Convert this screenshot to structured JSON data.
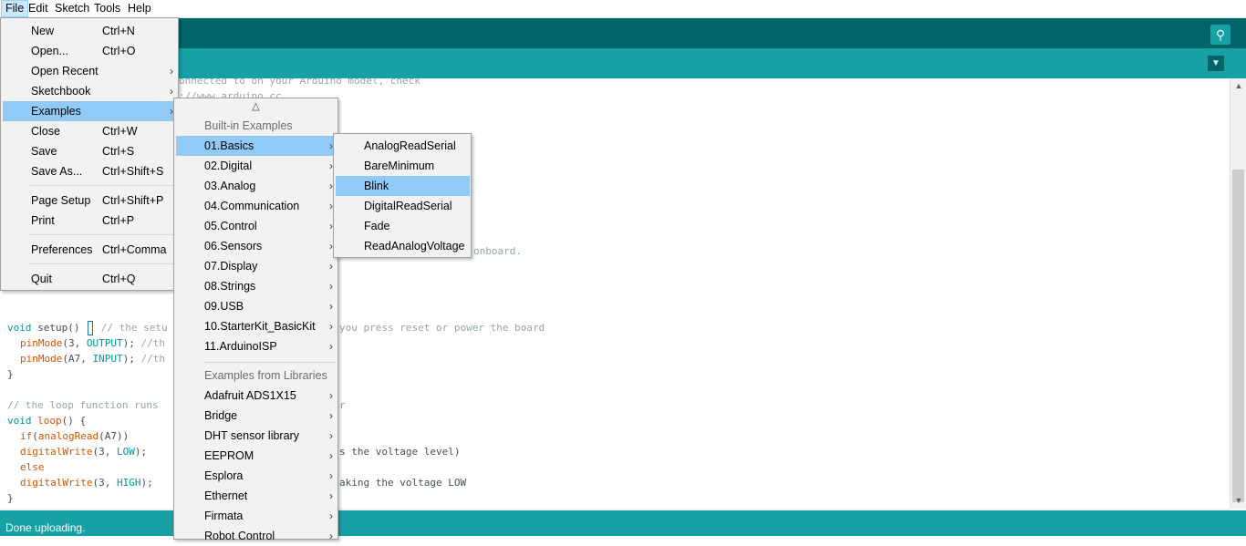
{
  "menubar": {
    "items": [
      "File",
      "Edit",
      "Sketch",
      "Tools",
      "Help"
    ]
  },
  "toolbar": {
    "serial_monitor_icon": "magnifier-icon",
    "tab_menu_icon": "triangle-down-icon"
  },
  "code": {
    "comment_top1": "onnected to on your Arduino model, check",
    "comment_top2": "://www.arduino.cc",
    "comment_onboard": "onboard.",
    "setup_line": "void setup() ",
    "setup_comment": "// the setu",
    "setup_trail": "you press reset or power the board",
    "pm1": "pinMode(3, OUTPUT); //th",
    "pm2": "pinMode(A7, INPUT); //th",
    "brace_close": "}",
    "loop_comment": "// the loop function runs",
    "loop_trail": "r",
    "loop_line": "void loop() {",
    "if_line": "if(analogRead(A7))",
    "dw_low": "digitalWrite(3, LOW);",
    "dw_low_trail": "s the voltage level)",
    "else_line": "else",
    "dw_high": "digitalWrite(3, HIGH);",
    "dw_high_trail": "aking the voltage LOW",
    "end_brace": "}"
  },
  "file_menu": {
    "items": [
      {
        "label": "New",
        "shortcut": "Ctrl+N"
      },
      {
        "label": "Open...",
        "shortcut": "Ctrl+O"
      },
      {
        "label": "Open Recent",
        "shortcut": ""
      },
      {
        "label": "Sketchbook",
        "shortcut": ""
      },
      {
        "label": "Examples",
        "shortcut": ""
      },
      {
        "label": "Close",
        "shortcut": "Ctrl+W"
      },
      {
        "label": "Save",
        "shortcut": "Ctrl+S"
      },
      {
        "label": "Save As...",
        "shortcut": "Ctrl+Shift+S"
      },
      {
        "label": "Page Setup",
        "shortcut": "Ctrl+Shift+P"
      },
      {
        "label": "Print",
        "shortcut": "Ctrl+P"
      },
      {
        "label": "Preferences",
        "shortcut": "Ctrl+Comma"
      },
      {
        "label": "Quit",
        "shortcut": "Ctrl+Q"
      }
    ]
  },
  "examples_menu": {
    "up_arrow": "△",
    "builtin_header": "Built-in Examples",
    "builtin": [
      "01.Basics",
      "02.Digital",
      "03.Analog",
      "04.Communication",
      "05.Control",
      "06.Sensors",
      "07.Display",
      "08.Strings",
      "09.USB",
      "10.StarterKit_BasicKit",
      "11.ArduinoISP"
    ],
    "libraries_header": "Examples from Libraries",
    "libraries": [
      "Adafruit ADS1X15",
      "Bridge",
      "DHT sensor library",
      "EEPROM",
      "Esplora",
      "Ethernet",
      "Firmata",
      "Robot Control"
    ]
  },
  "basics_menu": {
    "items": [
      "AnalogReadSerial",
      "BareMinimum",
      "Blink",
      "DigitalReadSerial",
      "Fade",
      "ReadAnalogVoltage"
    ]
  },
  "status": {
    "text": "Done uploading."
  },
  "colors": {
    "toolbar": "#006468",
    "tabbar": "#17a1a5",
    "highlight": "#91c9f7",
    "status": "#17a1a5"
  }
}
